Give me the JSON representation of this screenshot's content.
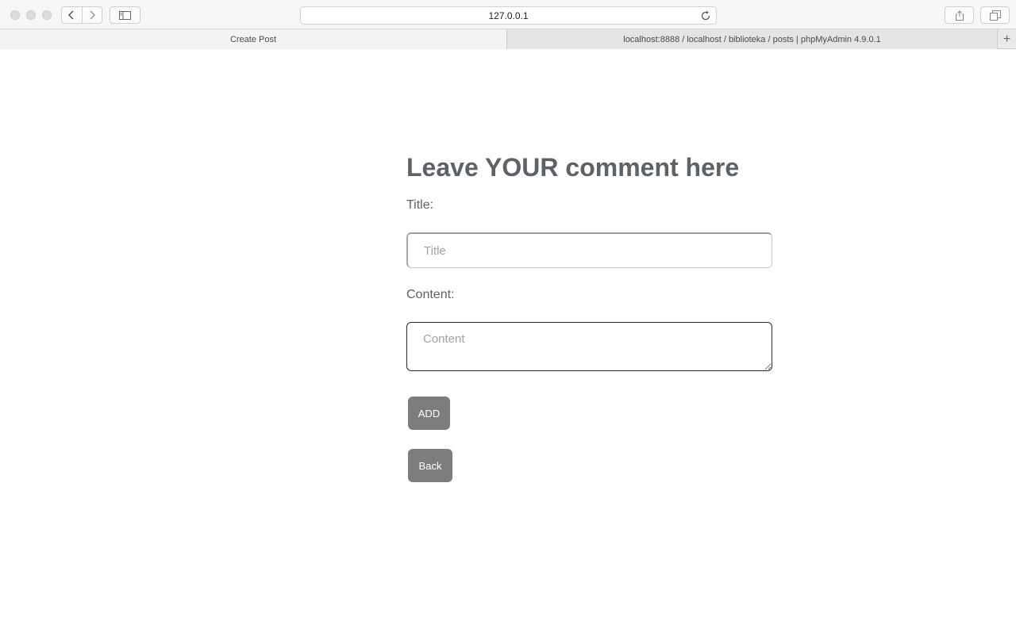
{
  "browser": {
    "address": "127.0.0.1",
    "tabs": [
      {
        "label": "Create Post",
        "active": true
      },
      {
        "label": "localhost:8888 / localhost / biblioteka / posts | phpMyAdmin 4.9.0.1",
        "active": false
      }
    ],
    "new_tab_label": "+",
    "icons": [
      "back-icon",
      "forward-icon",
      "sidebar-icon",
      "reload-icon",
      "share-icon",
      "tabs-overview-icon",
      "new-tab-icon"
    ]
  },
  "page": {
    "heading": "Leave YOUR comment here",
    "title_label": "Title:",
    "title_placeholder": "Title",
    "content_label": "Content:",
    "content_placeholder": "Content",
    "add_button": "ADD",
    "back_button": "Back"
  },
  "colors": {
    "heading_text": "#5d6268",
    "button_bg": "#7d7d7d",
    "button_text": "#ffffff",
    "placeholder": "#a3a3a3"
  }
}
